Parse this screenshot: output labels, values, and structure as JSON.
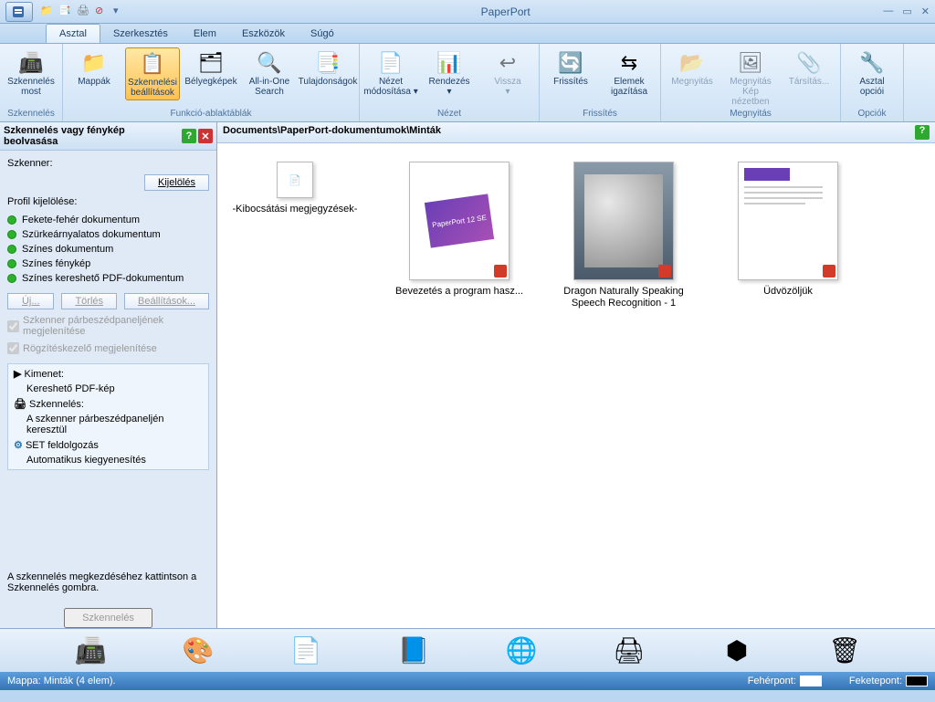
{
  "app": {
    "title": "PaperPort"
  },
  "tabs": [
    "Asztal",
    "Szerkesztés",
    "Elem",
    "Eszközök",
    "Súgó"
  ],
  "active_tab": 0,
  "ribbon": {
    "groups": [
      {
        "label": "Szkennelés",
        "items": [
          {
            "name": "scan-now",
            "text": "Szkennelés most",
            "icon": "📠"
          }
        ]
      },
      {
        "label": "Funkció-ablaktáblák",
        "items": [
          {
            "name": "folders",
            "text": "Mappák",
            "icon": "📁"
          },
          {
            "name": "scan-settings",
            "text": "Szkennelési beállítások",
            "icon": "📋",
            "selected": true
          },
          {
            "name": "thumbs",
            "text": "Bélyegképek",
            "icon": "🗂"
          },
          {
            "name": "allinone",
            "text": "All-in-One Search",
            "icon": "🔍"
          },
          {
            "name": "properties",
            "text": "Tulajdonságok",
            "icon": "📑"
          }
        ]
      },
      {
        "label": "Nézet",
        "items": [
          {
            "name": "view-mod",
            "text": "Nézet módosítása ▾",
            "icon": "📄"
          },
          {
            "name": "sort",
            "text": "Rendezés ▾",
            "icon": "📊"
          },
          {
            "name": "back",
            "text": "Vissza ▾",
            "icon": "↩",
            "disabled": true
          }
        ]
      },
      {
        "label": "Frissítés",
        "items": [
          {
            "name": "refresh",
            "text": "Frissítés",
            "icon": "🔄"
          },
          {
            "name": "align",
            "text": "Elemek igazítása",
            "icon": "⇆"
          }
        ]
      },
      {
        "label": "Megnyitás",
        "items": [
          {
            "name": "open",
            "text": "Megnyitás",
            "icon": "📂",
            "disabled": true
          },
          {
            "name": "open-imgview",
            "text": "Megnyitás Kép nézetben",
            "icon": "🖼",
            "disabled": true
          },
          {
            "name": "assoc",
            "text": "Társítás...",
            "icon": "📎",
            "disabled": true
          }
        ]
      },
      {
        "label": "Opciók",
        "items": [
          {
            "name": "desk-opts",
            "text": "Asztal opciói",
            "icon": "🔧"
          }
        ]
      }
    ]
  },
  "sidepanel": {
    "title": "Szkennelés vagy fénykép beolvasása",
    "scanner_label": "Szkenner:",
    "select_btn": "Kijelölés",
    "profile_label": "Profil kijelölése:",
    "profiles": [
      "Fekete-fehér dokumentum",
      "Szürkeárnyalatos dokumentum",
      "Színes dokumentum",
      "Színes fénykép",
      "Színes kereshető PDF-dokumentum"
    ],
    "btn_new": "Új...",
    "btn_delete": "Törlés",
    "btn_settings": "Beállítások...",
    "chk_dialog": "Szkenner párbeszédpaneljének megjelenítése",
    "chk_capture": "Rögzítéskezelő megjelenítése",
    "info": {
      "output_h": "Kimenet:",
      "output_v": "Kereshető PDF-kép",
      "scan_h": "Szkennelés:",
      "scan_v": "A szkenner párbeszédpaneljén keresztül",
      "set_h": "SET feldolgozás",
      "set_v": "Automatikus kiegyenesítés"
    },
    "hint": "A szkennelés megkezdéséhez kattintson a Szkennelés gombra.",
    "scan_btn": "Szkennelés"
  },
  "main": {
    "breadcrumb": "Documents\\PaperPort-dokumentumok\\Minták",
    "files": [
      {
        "name": "file-kibocs",
        "label": "-Kibocsátási megjegyzések-",
        "thumb": "icon"
      },
      {
        "name": "file-bevez",
        "label": "Bevezetés a program hasz...",
        "thumb": "pp12"
      },
      {
        "name": "file-dragon",
        "label": "Dragon Naturally Speaking Speech Recognition - 1",
        "thumb": "photo"
      },
      {
        "name": "file-udv",
        "label": "Üdvözöljük",
        "thumb": "doc"
      }
    ]
  },
  "bottombar": [
    "📠",
    "🎨",
    "📄",
    "📘",
    "🌐",
    "🖨",
    "⬢",
    "🗑"
  ],
  "status": {
    "folder": "Mappa: Minták (4 elem).",
    "white": "Fehérpont:",
    "black": "Feketepont:"
  }
}
